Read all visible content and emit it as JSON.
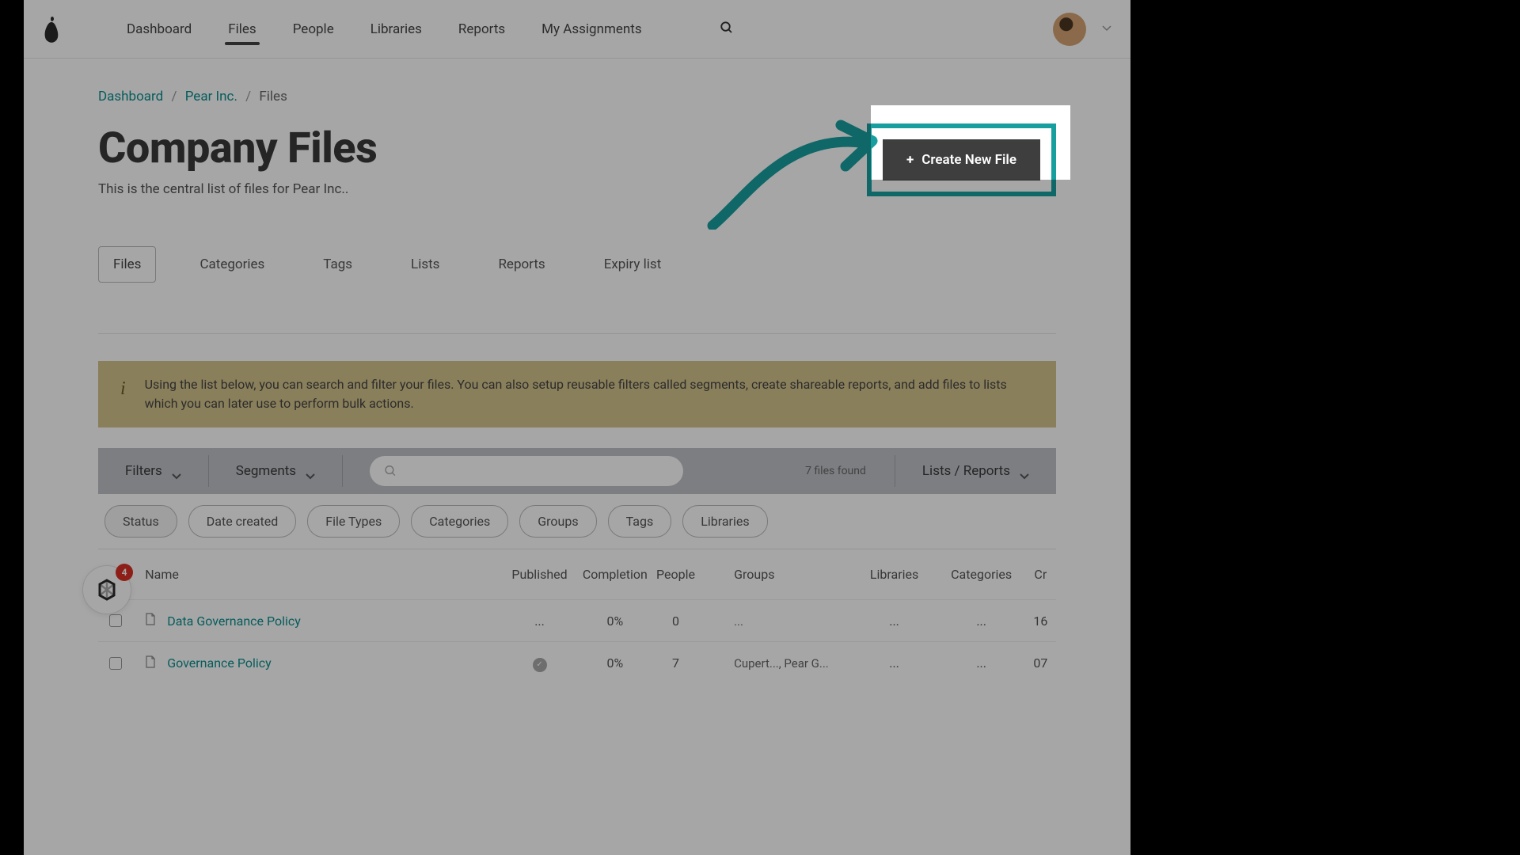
{
  "topnav": {
    "items": [
      "Dashboard",
      "Files",
      "People",
      "Libraries",
      "Reports",
      "My Assignments"
    ],
    "active_index": 1
  },
  "breadcrumb": {
    "parts": [
      "Dashboard",
      "Pear Inc.",
      "Files"
    ]
  },
  "page": {
    "title": "Company Files",
    "subtitle": "This is the central list of files for Pear Inc.."
  },
  "create_button": {
    "plus": "+",
    "label": "Create New File"
  },
  "sub_tabs": {
    "items": [
      "Files",
      "Categories",
      "Tags",
      "Lists",
      "Reports",
      "Expiry list"
    ],
    "active_index": 0
  },
  "info": {
    "icon": "i",
    "text": "Using the list below, you can search and filter your files. You can also setup reusable filters called segments, create shareable reports, and add files to lists which you can later use to perform bulk actions."
  },
  "toolbar": {
    "filters": "Filters",
    "segments": "Segments",
    "search_placeholder": "",
    "count": "7 files found",
    "reports": "Lists / Reports"
  },
  "chips": [
    "Status",
    "Date created",
    "File Types",
    "Categories",
    "Groups",
    "Tags",
    "Libraries"
  ],
  "table": {
    "headers": {
      "name": "Name",
      "published": "Published",
      "completion": "Completion",
      "people": "People",
      "groups": "Groups",
      "libraries": "Libraries",
      "categories": "Categories",
      "cr": "Cr"
    },
    "rows": [
      {
        "name": "Data Governance Policy",
        "published": "...",
        "published_check": false,
        "completion": "0%",
        "people": "0",
        "groups": "...",
        "libraries": "...",
        "categories": "...",
        "cr": "16"
      },
      {
        "name": "Governance Policy",
        "published": "",
        "published_check": true,
        "completion": "0%",
        "people": "7",
        "groups": "Cupert..., Pear G...",
        "libraries": "...",
        "categories": "...",
        "cr": "07"
      }
    ]
  },
  "widget": {
    "badge": "4"
  },
  "colors": {
    "accent": "#179e9e",
    "link": "#0b8e8e",
    "banner": "#d5c48d"
  }
}
